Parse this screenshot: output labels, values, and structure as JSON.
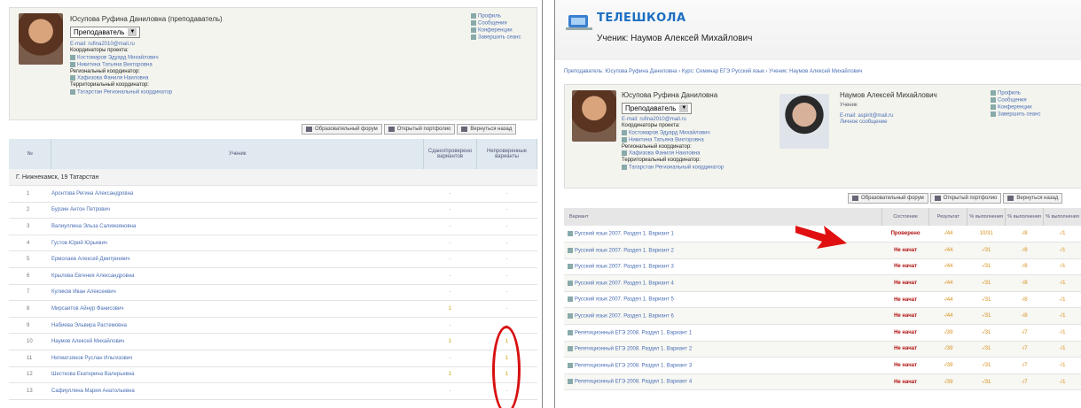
{
  "left": {
    "teacher_name": "Юсупова Руфина Даниловна (преподаватель)",
    "role_select": "Преподаватель",
    "profile_lines": [
      {
        "text": "E-mail: rufina2010@mail.ru",
        "kind": "lnk"
      },
      {
        "text": "Координаторы проекта:",
        "kind": "lbl"
      },
      {
        "text": "Костомаров Эдуард Михайлович",
        "kind": "lnk"
      },
      {
        "text": "Никитина Татьяна Викторовна",
        "kind": "lnk"
      },
      {
        "text": "Региональный координатор:",
        "kind": "lbl"
      },
      {
        "text": "Хафизова Фаниля Наиловна",
        "kind": "lnk"
      },
      {
        "text": "Территориальный координатор:",
        "kind": "lbl"
      },
      {
        "text": "Татарстан Региональный координатор",
        "kind": "lnk"
      }
    ],
    "menu": [
      "Профиль",
      "Сообщения",
      "Конференции",
      "Завершить сеанс"
    ],
    "buttons": [
      "Образовательный форум",
      "Открытый портфолио",
      "Вернуться назад"
    ],
    "table_headers": [
      "№",
      "Ученик",
      "Сдано/проверено вариантов",
      "Непроверенные варианты"
    ],
    "group": "Г. Нижнекамск, 19 Татарстан",
    "students": [
      {
        "n": "1",
        "name": "Аронтова Регина Александровна",
        "a": "-",
        "b": "-"
      },
      {
        "n": "2",
        "name": "Бурзин Антон Петрович",
        "a": "-",
        "b": "-"
      },
      {
        "n": "3",
        "name": "Валиуллина Эльза Салимзяновна",
        "a": "-",
        "b": "-"
      },
      {
        "n": "4",
        "name": "Густов Юрий Юрьевич",
        "a": "-",
        "b": "-"
      },
      {
        "n": "5",
        "name": "Ермолаев Алексей Дмитриевич",
        "a": "-",
        "b": "-"
      },
      {
        "n": "6",
        "name": "Крылова Евгения Александровна",
        "a": "-",
        "b": "-"
      },
      {
        "n": "7",
        "name": "Куликов Иван Алексеевич",
        "a": "-",
        "b": "-"
      },
      {
        "n": "8",
        "name": "Мирсаитов Айнур Фанисович",
        "a": "1",
        "b": "-"
      },
      {
        "n": "9",
        "name": "Набиева Эльвира Растемовна",
        "a": "-",
        "b": "-"
      },
      {
        "n": "10",
        "name": "Наумов Алексей Михайлович",
        "a": "1",
        "b": "1"
      },
      {
        "n": "11",
        "name": "Нигматзянов Руслан Ильгизович",
        "a": "-",
        "b": "1"
      },
      {
        "n": "12",
        "name": "Шесткова Екатерина Валерьевна",
        "a": "1",
        "b": "1"
      },
      {
        "n": "13",
        "name": "Сафиуллина Мария Анатольевна",
        "a": "-",
        "b": "-"
      }
    ]
  },
  "right": {
    "logo": "ТЕЛЕШКОЛА",
    "student_title": "Ученик: Наумов Алексей Михайлович",
    "breadcrumb": "Преподаватель: Юсупова Руфина Даниловна › Курс: Семинар ЕГЭ Русский язык › Ученик: Наумов Алексей Михайлович",
    "teacher_name": "Юсупова Руфина Даниловна",
    "role_select": "Преподаватель",
    "profile_lines": [
      {
        "text": "E-mail: rufina2010@mail.ru",
        "kind": "lnk"
      },
      {
        "text": "Координаторы проекта:",
        "kind": "lbl"
      },
      {
        "text": "Костомаров Эдуард Михайлович",
        "kind": "lnk"
      },
      {
        "text": "Никитина Татьяна Викторовна",
        "kind": "lnk"
      },
      {
        "text": "Региональный координатор:",
        "kind": "lbl"
      },
      {
        "text": "Хафизова Фаниля Наиловна",
        "kind": "lnk"
      },
      {
        "text": "Территориальный координатор:",
        "kind": "lbl"
      },
      {
        "text": "Татарстан Региональный координатор",
        "kind": "lnk"
      }
    ],
    "student_name": "Наумов Алексей Михайлович",
    "student_role": "Ученик",
    "student_lines": [
      "E-mail: aspirit@mail.ru",
      "Личное сообщение"
    ],
    "menu": [
      "Профиль",
      "Сообщения",
      "Конференции",
      "Завершить сеанс"
    ],
    "buttons": [
      "Образовательный форум",
      "Открытый портфолио",
      "Вернуться назад"
    ],
    "table_headers": [
      "Вариант",
      "Состояние",
      "Результат",
      "% выполнения",
      "% выполнения",
      "% выполнения"
    ],
    "variants": [
      {
        "name": "Русский язык 2007. Раздел 1. Вариант 1",
        "status": "Проверено",
        "r": "-/44",
        "p1": "10/31",
        "p2": "-/8",
        "p3": "-/1"
      },
      {
        "name": "Русский язык 2007. Раздел 1. Вариант 2",
        "status": "Не начат",
        "r": "-/44",
        "p1": "-/31",
        "p2": "-/8",
        "p3": "-/1"
      },
      {
        "name": "Русский язык 2007. Раздел 1. Вариант 3",
        "status": "Не начат",
        "r": "-/44",
        "p1": "-/31",
        "p2": "-/8",
        "p3": "-/1"
      },
      {
        "name": "Русский язык 2007. Раздел 1. Вариант 4",
        "status": "Не начат",
        "r": "-/44",
        "p1": "-/31",
        "p2": "-/8",
        "p3": "-/1"
      },
      {
        "name": "Русский язык 2007. Раздел 1. Вариант 5",
        "status": "Не начат",
        "r": "-/44",
        "p1": "-/31",
        "p2": "-/8",
        "p3": "-/1"
      },
      {
        "name": "Русский язык 2007. Раздел 1. Вариант 6",
        "status": "Не начат",
        "r": "-/44",
        "p1": "-/31",
        "p2": "-/8",
        "p3": "-/1"
      },
      {
        "name": "Репетиционный ЕГЭ 2008. Раздел 1. Вариант 1",
        "status": "Не начат",
        "r": "-/39",
        "p1": "-/31",
        "p2": "-/7",
        "p3": "-/1"
      },
      {
        "name": "Репетиционный ЕГЭ 2008. Раздел 1. Вариант 2",
        "status": "Не начат",
        "r": "-/39",
        "p1": "-/31",
        "p2": "-/7",
        "p3": "-/1"
      },
      {
        "name": "Репетиционный ЕГЭ 2008. Раздел 1. Вариант 3",
        "status": "Не начат",
        "r": "-/39",
        "p1": "-/31",
        "p2": "-/7",
        "p3": "-/1"
      },
      {
        "name": "Репетиционный ЕГЭ 2008. Раздел 1. Вариант 4",
        "status": "Не начат",
        "r": "-/39",
        "p1": "-/31",
        "p2": "-/7",
        "p3": "-/1"
      }
    ]
  },
  "annotation_color": "#d81010"
}
